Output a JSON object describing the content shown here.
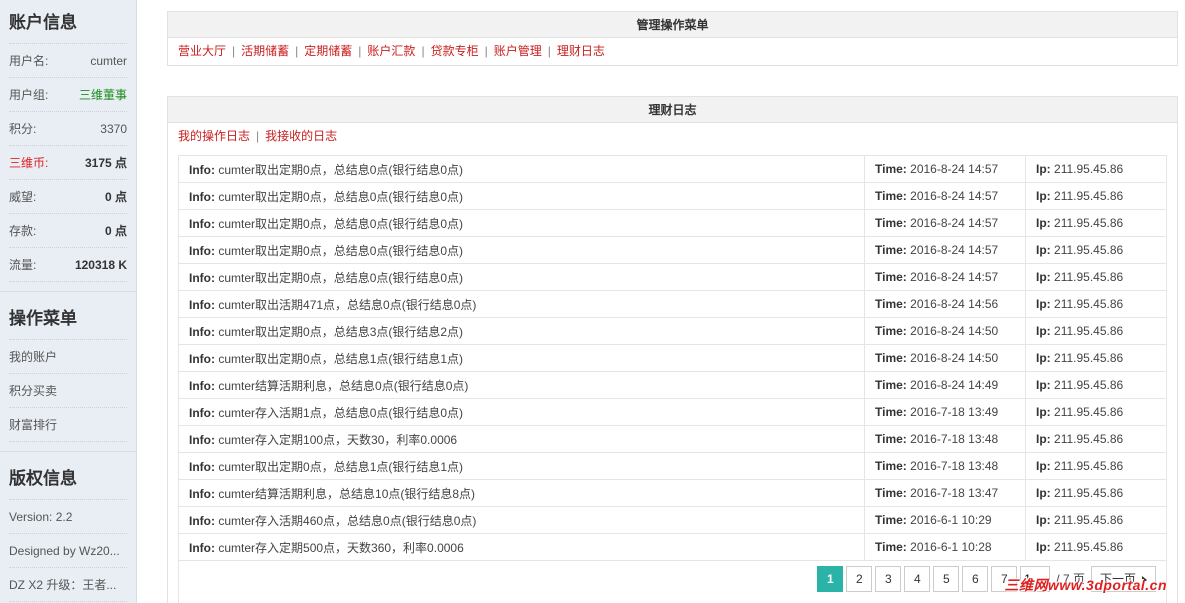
{
  "sidebar": {
    "account_title": "账户信息",
    "account_rows": [
      {
        "label": "用户名:",
        "value": "cumter"
      },
      {
        "label": "用户组:",
        "value": "三维董事"
      },
      {
        "label": "积分:",
        "value": "3370"
      },
      {
        "label": "三维币:",
        "value": "3175 点"
      },
      {
        "label": "威望:",
        "value": "0 点"
      },
      {
        "label": "存款:",
        "value": "0 点"
      },
      {
        "label": "流量:",
        "value": "120318 K"
      }
    ],
    "menu_title": "操作菜单",
    "menu_items": [
      "我的账户",
      "积分买卖",
      "财富排行"
    ],
    "copyright_title": "版权信息",
    "copyright_items": [
      "Version: 2.2",
      "Designed by Wz20...",
      "DZ X2 升级：王者..."
    ]
  },
  "menu_panel": {
    "title": "管理操作菜单",
    "links": [
      "营业大厅",
      "活期储蓄",
      "定期储蓄",
      "账户汇款",
      "贷款专柜",
      "账户管理",
      "理财日志"
    ],
    "separator": "|"
  },
  "log_panel": {
    "title": "理财日志",
    "tabs": [
      "我的操作日志",
      "我接收的日志"
    ],
    "labels": {
      "info": "Info:",
      "time": "Time:",
      "ip": "Ip:"
    },
    "rows": [
      {
        "info": "cumter取出定期0点，总结息0点(银行结息0点)",
        "time": "2016-8-24 14:57",
        "ip": "211.95.45.86"
      },
      {
        "info": "cumter取出定期0点，总结息0点(银行结息0点)",
        "time": "2016-8-24 14:57",
        "ip": "211.95.45.86"
      },
      {
        "info": "cumter取出定期0点，总结息0点(银行结息0点)",
        "time": "2016-8-24 14:57",
        "ip": "211.95.45.86"
      },
      {
        "info": "cumter取出定期0点，总结息0点(银行结息0点)",
        "time": "2016-8-24 14:57",
        "ip": "211.95.45.86"
      },
      {
        "info": "cumter取出定期0点，总结息0点(银行结息0点)",
        "time": "2016-8-24 14:57",
        "ip": "211.95.45.86"
      },
      {
        "info": "cumter取出活期471点，总结息0点(银行结息0点)",
        "time": "2016-8-24 14:56",
        "ip": "211.95.45.86"
      },
      {
        "info": "cumter取出定期0点，总结息3点(银行结息2点)",
        "time": "2016-8-24 14:50",
        "ip": "211.95.45.86"
      },
      {
        "info": "cumter取出定期0点，总结息1点(银行结息1点)",
        "time": "2016-8-24 14:50",
        "ip": "211.95.45.86"
      },
      {
        "info": "cumter结算活期利息，总结息0点(银行结息0点)",
        "time": "2016-8-24 14:49",
        "ip": "211.95.45.86"
      },
      {
        "info": "cumter存入活期1点，总结息0点(银行结息0点)",
        "time": "2016-7-18 13:49",
        "ip": "211.95.45.86"
      },
      {
        "info": "cumter存入定期100点，天数30，利率0.0006",
        "time": "2016-7-18 13:48",
        "ip": "211.95.45.86"
      },
      {
        "info": "cumter取出定期0点，总结息1点(银行结息1点)",
        "time": "2016-7-18 13:48",
        "ip": "211.95.45.86"
      },
      {
        "info": "cumter结算活期利息，总结息10点(银行结息8点)",
        "time": "2016-7-18 13:47",
        "ip": "211.95.45.86"
      },
      {
        "info": "cumter存入活期460点，总结息0点(银行结息0点)",
        "time": "2016-6-1 10:29",
        "ip": "211.95.45.86"
      },
      {
        "info": "cumter存入定期500点，天数360，利率0.0006",
        "time": "2016-6-1 10:28",
        "ip": "211.95.45.86"
      }
    ]
  },
  "pager": {
    "pages": [
      "1",
      "2",
      "3",
      "4",
      "5",
      "6",
      "7"
    ],
    "current": "1",
    "input_value": "1",
    "total_label": "/ 7 页",
    "next_label": "下一页"
  },
  "watermark": "三维网www.3dportal.cn",
  "colors": {
    "link_red": "#c81e1e",
    "active_page": "#2ab3a6",
    "sidebar_bg": "#e8eef4",
    "group_green": "#1a8c1a"
  }
}
